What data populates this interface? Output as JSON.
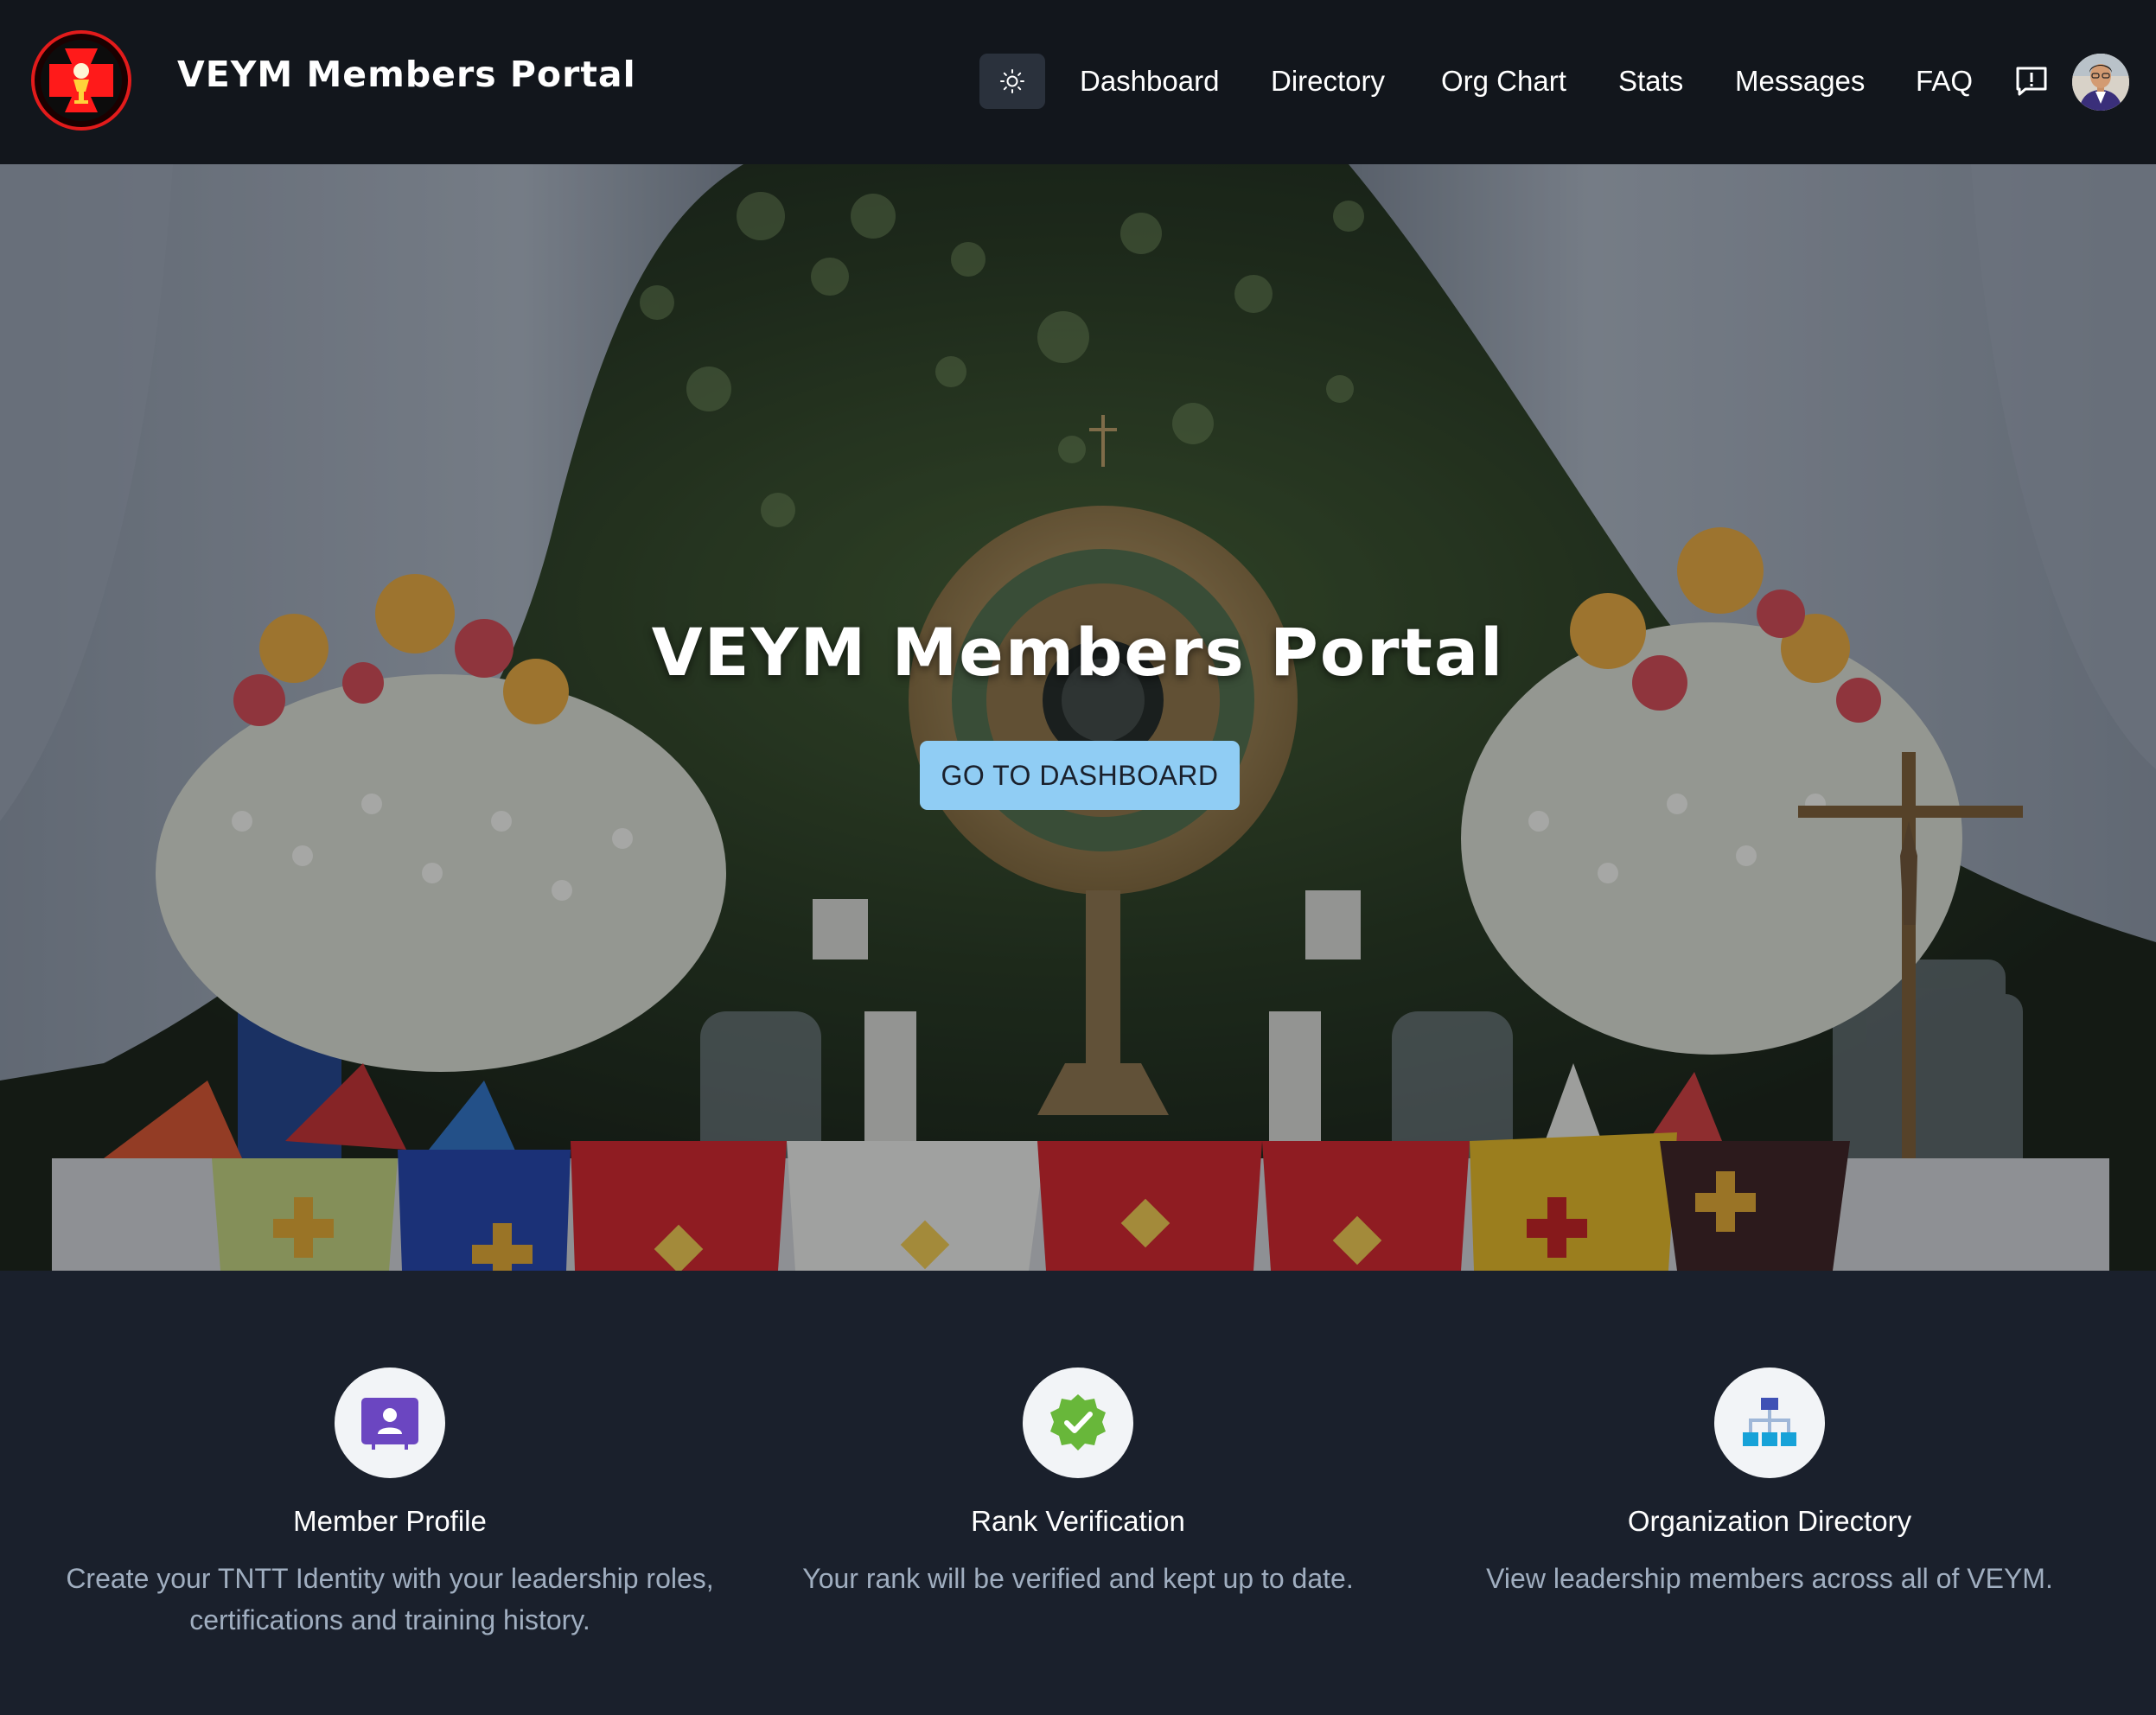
{
  "header": {
    "brand": "VEYM Members Portal",
    "logo_icon": "veym-cross-logo",
    "theme_icon": "sun-icon",
    "nav": [
      "Dashboard",
      "Directory",
      "Org Chart",
      "Stats",
      "Messages",
      "FAQ"
    ],
    "feedback_icon": "feedback-icon",
    "avatar_icon": "user-avatar"
  },
  "hero": {
    "title": "VEYM Members Portal",
    "cta": "GO TO DASHBOARD"
  },
  "features": [
    {
      "icon": "member-profile-icon",
      "title": "Member Profile",
      "text": "Create your TNTT Identity with your leadership roles, certifications and training history."
    },
    {
      "icon": "verified-badge-icon",
      "title": "Rank Verification",
      "text": "Your rank will be verified and kept up to date."
    },
    {
      "icon": "org-chart-icon",
      "title": "Organization Directory",
      "text": "View leadership members across all of VEYM."
    }
  ],
  "colors": {
    "navbar_bg": "#12161c",
    "page_bg": "#1a202c",
    "cta_bg": "#90cdf4",
    "cta_text": "#1a202c",
    "muted_text": "#a0aec0",
    "profile_icon": "#6b46c1",
    "verified_icon": "#68b73a",
    "org_icon_top": "#3f51b5",
    "org_icon_bottom": "#17a2d8"
  }
}
